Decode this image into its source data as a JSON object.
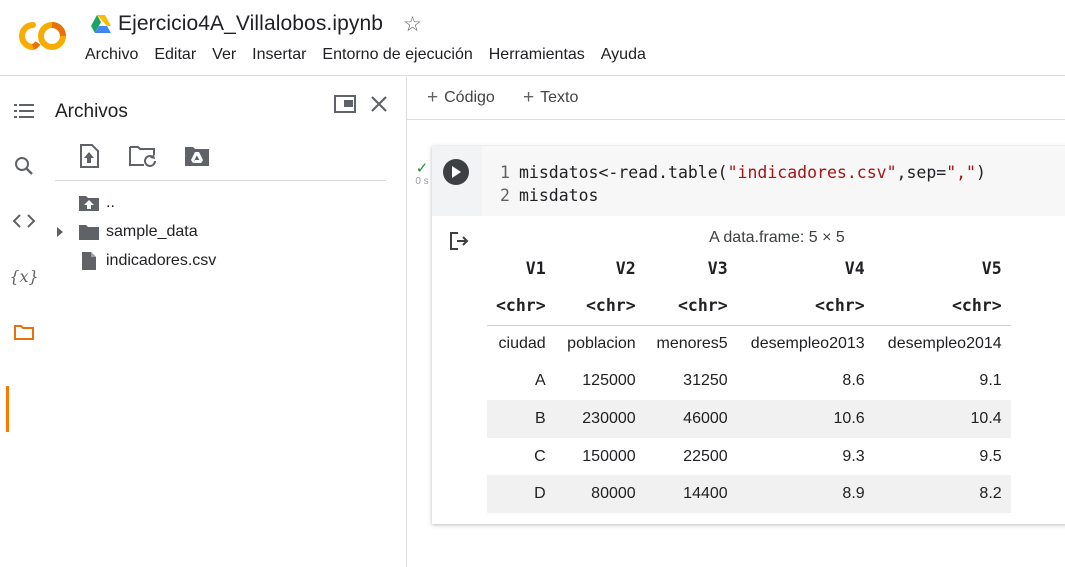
{
  "app": {
    "notebook_title": "Ejercicio4A_Villalobos.ipynb",
    "menu": [
      "Archivo",
      "Editar",
      "Ver",
      "Insertar",
      "Entorno de ejecución",
      "Herramientas",
      "Ayuda"
    ]
  },
  "rail": {
    "icons": [
      "toc-icon",
      "search-icon",
      "code-snippets-icon",
      "variables-icon",
      "folder-icon"
    ],
    "active": "folder-icon"
  },
  "files_panel": {
    "title": "Archivos",
    "items": [
      {
        "label": "..",
        "icon": "folder-up-icon"
      },
      {
        "label": "sample_data",
        "icon": "folder-icon"
      },
      {
        "label": "indicadores.csv",
        "icon": "file-icon"
      }
    ]
  },
  "toolbar": {
    "add_code": "Código",
    "add_text": "Texto"
  },
  "cell": {
    "status_time": "0 s",
    "code_lines": [
      {
        "num": "1",
        "pre": "misdatos<-read.table(",
        "str1": "\"indicadores.csv\"",
        "mid": ",sep=",
        "str2": "\",\"",
        "post": ")"
      },
      {
        "num": "2",
        "pre": "misdatos",
        "str1": "",
        "mid": "",
        "str2": "",
        "post": ""
      }
    ],
    "output": {
      "caption": "A data.frame: 5 × 5",
      "columns": [
        "V1",
        "V2",
        "V3",
        "V4",
        "V5"
      ],
      "types": [
        "<chr>",
        "<chr>",
        "<chr>",
        "<chr>",
        "<chr>"
      ],
      "rows": [
        [
          "ciudad",
          "poblacion",
          "menores5",
          "desempleo2013",
          "desempleo2014"
        ],
        [
          "A",
          "125000",
          "31250",
          "8.6",
          "9.1"
        ],
        [
          "B",
          "230000",
          "46000",
          "10.6",
          "10.4"
        ],
        [
          "C",
          "150000",
          "22500",
          "9.3",
          "9.5"
        ],
        [
          "D",
          "80000",
          "14400",
          "8.9",
          "8.2"
        ]
      ]
    }
  },
  "colors": {
    "accent": "#f57c00",
    "string": "#a31515",
    "run_button": "#3c4043"
  }
}
